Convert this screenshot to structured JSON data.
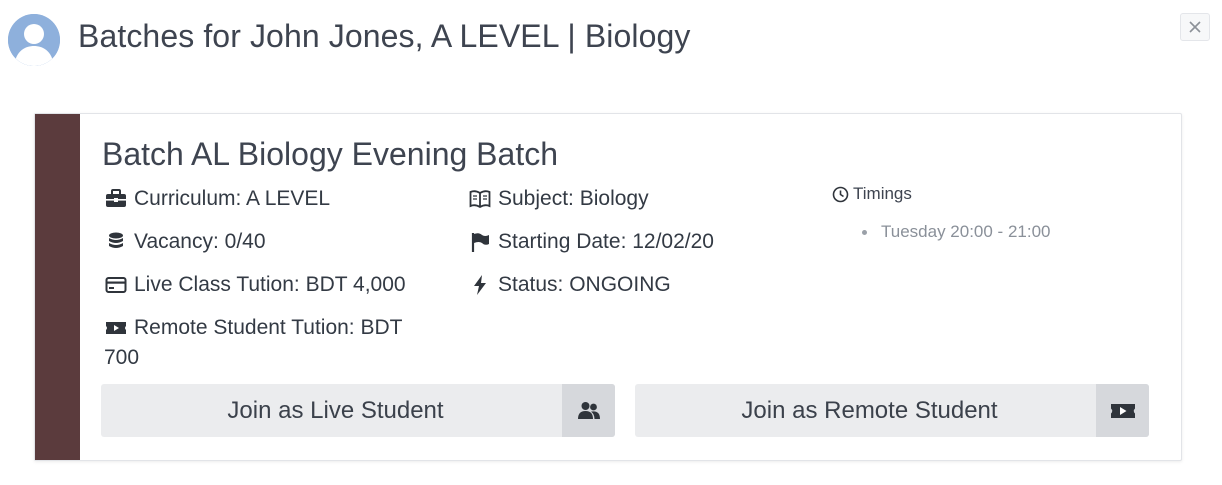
{
  "header": {
    "title": "Batches for John Jones, A LEVEL | Biology",
    "close_label": "×"
  },
  "batch": {
    "title": "Batch AL Biology Evening Batch",
    "curriculum": "Curriculum: A LEVEL",
    "vacancy": "Vacancy: 0/40",
    "live_tuition": "Live Class Tution: BDT 4,000",
    "remote_tuition": "Remote Student Tution: BDT 700",
    "subject": "Subject: Biology",
    "starting_date": "Starting Date: 12/02/20",
    "status": "Status: ONGOING",
    "timings_label": "Timings",
    "timings": [
      "Tuesday 20:00 - 21:00"
    ],
    "join_live_label": "Join as Live Student",
    "join_remote_label": "Join as Remote Student"
  },
  "colors": {
    "accent_bar": "#5b3b3d",
    "avatar_bg": "#8eb0dc",
    "button_bg": "#ebecee",
    "button_addon_bg": "#d6d8dc"
  },
  "icons": {
    "avatar": "user-avatar-icon",
    "close": "close-icon",
    "curriculum": "briefcase-icon",
    "vacancy": "database-icon",
    "live_tuition": "credit-card-icon",
    "remote_tuition": "video-ticket-icon",
    "subject": "book-open-icon",
    "starting_date": "flag-icon",
    "status": "bolt-icon",
    "timings": "clock-icon",
    "join_live": "users-icon",
    "join_remote": "video-ticket-icon"
  }
}
